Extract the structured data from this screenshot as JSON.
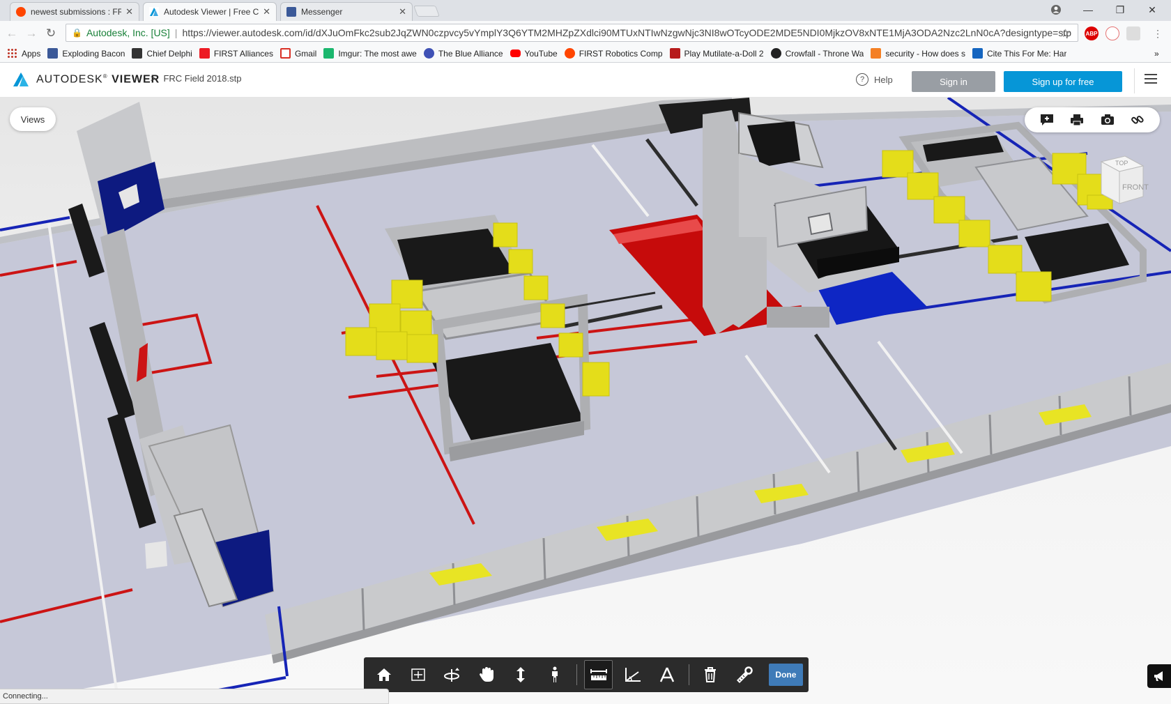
{
  "browser": {
    "tabs": [
      {
        "title": "newest submissions : FRC",
        "icon": "reddit-icon"
      },
      {
        "title": "Autodesk Viewer | Free C",
        "icon": "autodesk-icon"
      },
      {
        "title": "Messenger",
        "icon": "facebook-icon"
      }
    ],
    "address": {
      "site_name": "Autodesk, Inc. [US]",
      "url": "https://viewer.autodesk.com/id/dXJuOmFkc2sub2JqZWN0czpvcy5vYmplY3Q6YTM2MHZpZXdlci90MTUxNTIwNzgwNjc3NI8wOTcyODE2MDE5NDI0MjkzOV8xNTE1MjA3ODA2Nzc2LnN0cA?designtype=stp"
    },
    "bookmarks": [
      {
        "label": "Apps",
        "icon": "apps-grid-icon",
        "color": "#c0392b"
      },
      {
        "label": "Exploding Bacon",
        "icon": "facebook-icon",
        "color": "#3b5998"
      },
      {
        "label": "Chief Delphi",
        "icon": "chief-delphi-icon",
        "color": "#222222"
      },
      {
        "label": "FIRST Alliances",
        "icon": "first-icon",
        "color": "#ed1c24"
      },
      {
        "label": "Gmail",
        "icon": "gmail-icon",
        "color": "#d93025"
      },
      {
        "label": "Imgur: The most awe",
        "icon": "imgur-icon",
        "color": "#1bb76e"
      },
      {
        "label": "The Blue Alliance",
        "icon": "tba-icon",
        "color": "#3f51b5"
      },
      {
        "label": "YouTube",
        "icon": "youtube-icon",
        "color": "#ff0000"
      },
      {
        "label": "FIRST Robotics Comp",
        "icon": "reddit-icon",
        "color": "#ff4500"
      },
      {
        "label": "Play Mutilate-a-Doll 2",
        "icon": "k-icon",
        "color": "#b71c1c"
      },
      {
        "label": "Crowfall - Throne Wa",
        "icon": "crowfall-icon",
        "color": "#222222"
      },
      {
        "label": "security - How does s",
        "icon": "stackexchange-icon",
        "color": "#f48024"
      },
      {
        "label": "Cite This For Me: Har",
        "icon": "cite-icon",
        "color": "#1565c0"
      }
    ],
    "more_bookmarks": "»"
  },
  "app": {
    "brand_pre": "AUTODESK",
    "brand_reg": "®",
    "brand_post": "VIEWER",
    "breadcrumb_sep": ">",
    "file_name": "FRC Field 2018.stp",
    "help": "Help",
    "sign_in": "Sign in",
    "sign_up": "Sign up for free",
    "brand_color": "#0696d7"
  },
  "viewer": {
    "views_button": "Views",
    "viewcube": {
      "top": "TOP",
      "front": "FRONT"
    },
    "top_tools": [
      "comment-icon",
      "print-icon",
      "camera-icon",
      "link-icon"
    ],
    "toolbar_tools": [
      "home-icon",
      "fit-to-view-icon",
      "orbit-icon",
      "pan-icon",
      "dolly-icon",
      "first-person-icon",
      "measure-distance-icon",
      "measure-angle-icon",
      "calibrate-icon",
      "delete-icon",
      "settings-icon"
    ],
    "done": "Done",
    "status": "Connecting...",
    "field_colors": {
      "red": "#cc1010",
      "blue": "#0b1aa8",
      "yellow": "#e7e020",
      "black": "#151515",
      "floor": "#c7c9d9"
    }
  }
}
